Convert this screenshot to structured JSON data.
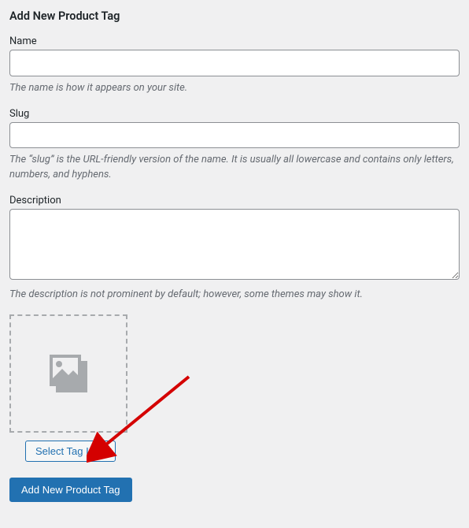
{
  "form": {
    "title": "Add New Product Tag",
    "name": {
      "label": "Name",
      "value": "",
      "help": "The name is how it appears on your site."
    },
    "slug": {
      "label": "Slug",
      "value": "",
      "help": "The “slug” is the URL-friendly version of the name. It is usually all lowercase and contains only letters, numbers, and hyphens."
    },
    "description": {
      "label": "Description",
      "value": "",
      "help": "The description is not prominent by default; however, some themes may show it."
    },
    "icon": {
      "select_label": "Select Tag Icon",
      "placeholder_icon": "image-placeholder-icon"
    },
    "submit_label": "Add New Product Tag"
  },
  "annotation": {
    "arrow_color": "#d40000"
  }
}
